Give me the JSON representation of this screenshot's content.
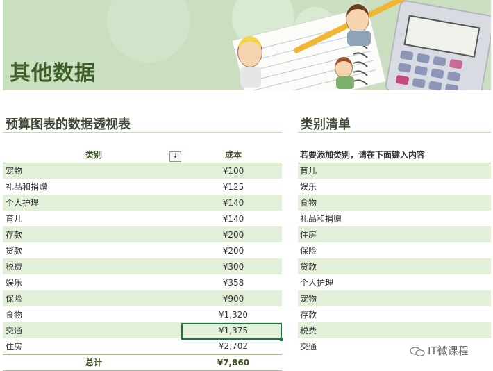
{
  "banner": {
    "title": "其他数据"
  },
  "pivot": {
    "title": "预算图表的数据透视表",
    "col_category": "类别",
    "col_cost": "成本",
    "filter_icon": "sort-filter-icon",
    "rows": [
      {
        "category": "宠物",
        "cost": "¥100"
      },
      {
        "category": "礼品和捐赠",
        "cost": "¥125"
      },
      {
        "category": "个人护理",
        "cost": "¥140"
      },
      {
        "category": "育儿",
        "cost": "¥140"
      },
      {
        "category": "存款",
        "cost": "¥200"
      },
      {
        "category": "贷款",
        "cost": "¥200"
      },
      {
        "category": "税费",
        "cost": "¥300"
      },
      {
        "category": "娱乐",
        "cost": "¥358"
      },
      {
        "category": "保险",
        "cost": "¥900"
      },
      {
        "category": "食物",
        "cost": "¥1,320"
      },
      {
        "category": "交通",
        "cost": "¥1,375"
      },
      {
        "category": "住房",
        "cost": "¥2,702"
      }
    ],
    "total_label": "总计",
    "total_value": "¥7,860"
  },
  "categories": {
    "title": "类别清单",
    "header": "若要添加类别，请在下面键入内容",
    "items": [
      "育儿",
      "娱乐",
      "食物",
      "礼品和捐赠",
      "住房",
      "保险",
      "贷款",
      "个人护理",
      "宠物",
      "存款",
      "税费",
      "交通"
    ]
  },
  "watermark": {
    "text": "IT微课程",
    "icon": "wechat-icon"
  },
  "colors": {
    "banner": "#c9dfc0",
    "band": "#e2efd9",
    "accent": "#217346",
    "title": "#3e5e2a"
  }
}
